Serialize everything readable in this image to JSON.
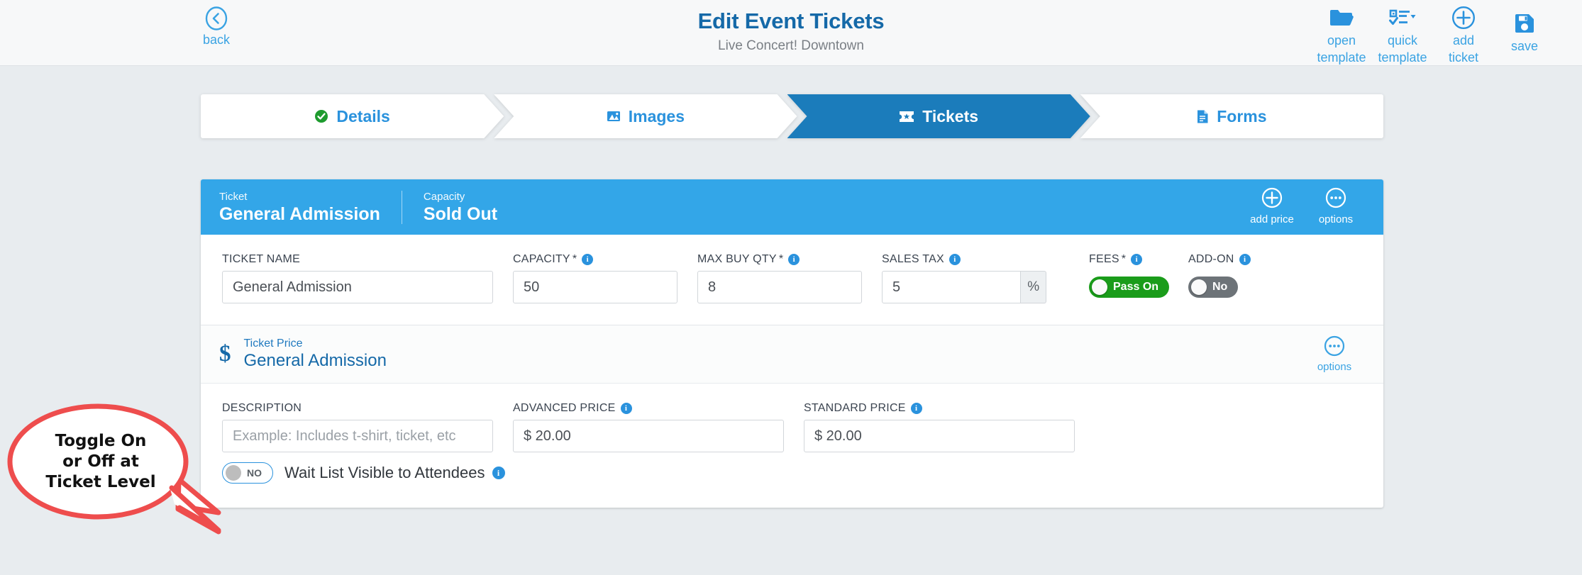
{
  "header": {
    "back_label": "back",
    "title": "Edit Event Tickets",
    "subtitle": "Live Concert! Downtown",
    "tools": [
      {
        "icon": "open-folder-icon",
        "line1": "open",
        "line2": "template"
      },
      {
        "icon": "quick-template-icon",
        "line1": "quick",
        "line2": "template"
      },
      {
        "icon": "plus-circle-icon",
        "line1": "add",
        "line2": "ticket"
      },
      {
        "icon": "floppy-disk-icon",
        "line1": "save",
        "line2": ""
      }
    ]
  },
  "steps": [
    {
      "label": "Details",
      "icon": "check-circle-icon",
      "active": false
    },
    {
      "label": "Images",
      "icon": "image-icon",
      "active": false
    },
    {
      "label": "Tickets",
      "icon": "ticket-icon",
      "active": true
    },
    {
      "label": "Forms",
      "icon": "document-icon",
      "active": false
    }
  ],
  "ticket_card": {
    "head": {
      "ticket_caption": "Ticket",
      "ticket_name": "General Admission",
      "capacity_caption": "Capacity",
      "capacity_value": "Sold Out",
      "add_price_label": "add price",
      "options_label": "options"
    },
    "fields": {
      "ticket_name_label": "TICKET NAME",
      "ticket_name_value": "General Admission",
      "capacity_label": "CAPACITY",
      "capacity_required": "*",
      "capacity_value": "50",
      "max_buy_label": "MAX BUY QTY",
      "max_buy_required": "*",
      "max_buy_value": "8",
      "sales_tax_label": "SALES TAX",
      "sales_tax_value": "5",
      "sales_tax_suffix": "%",
      "fees_label": "FEES",
      "fees_required": "*",
      "fees_toggle": "Pass On",
      "addon_label": "ADD-ON",
      "addon_toggle": "No"
    }
  },
  "price_section": {
    "caption": "Ticket Price",
    "name": "General Admission",
    "options_label": "options",
    "description_label": "DESCRIPTION",
    "description_placeholder": "Example: Includes t-shirt, ticket, etc",
    "description_value": "",
    "advanced_price_label": "ADVANCED PRICE",
    "advanced_price_value": "$ 20.00",
    "standard_price_label": "STANDARD PRICE",
    "standard_price_value": "$ 20.00",
    "waitlist_toggle": "NO",
    "waitlist_label": "Wait List Visible to Attendees"
  },
  "callout": {
    "text": "Toggle On or Off at Ticket Level",
    "line1": "Toggle On",
    "line2": "or Off at",
    "line3": "Ticket Level",
    "color": "#ee4d4d"
  },
  "colors": {
    "accent": "#2a92dd",
    "accent_dark": "#1b7cbb",
    "header_blue": "#33a6e8",
    "green": "#1a9c1a",
    "gray_toggle": "#6d7378",
    "page_bg": "#e8ecef"
  }
}
